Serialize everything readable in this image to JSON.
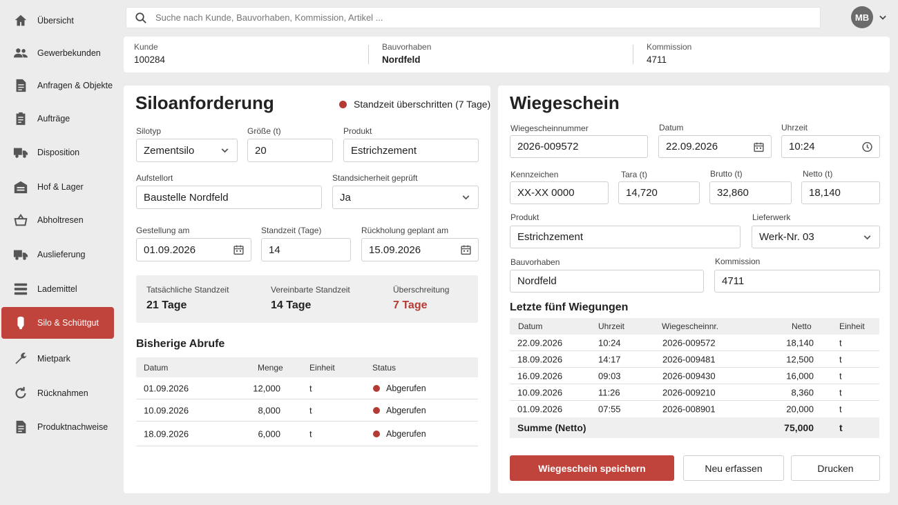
{
  "sidebar": {
    "items": [
      {
        "label": "Übersicht",
        "icon": "home-icon"
      },
      {
        "label": "Gewerbekunden",
        "icon": "users-icon"
      },
      {
        "label": "Anfragen & Objekte",
        "icon": "document-icon"
      },
      {
        "label": "Aufträge",
        "icon": "clipboard-icon"
      },
      {
        "label": "Disposition",
        "icon": "truck-icon"
      },
      {
        "label": "Hof & Lager",
        "icon": "warehouse-icon"
      },
      {
        "label": "Abholtresen",
        "icon": "basket-icon"
      },
      {
        "label": "Auslieferung",
        "icon": "delivery-truck-icon"
      },
      {
        "label": "Lademittel",
        "icon": "pallet-icon"
      },
      {
        "label": "Silo & Schüttgut",
        "icon": "silo-icon",
        "active": true
      },
      {
        "label": "Mietpark",
        "icon": "wrench-icon"
      },
      {
        "label": "Rücknahmen",
        "icon": "return-icon"
      },
      {
        "label": "Produktnachweise",
        "icon": "certificate-icon"
      }
    ]
  },
  "search": {
    "placeholder": "Suche nach Kunde, Bauvorhaben, Kommission, Artikel ..."
  },
  "user": {
    "initials": "MB"
  },
  "info": {
    "kunde_label": "Kunde",
    "kunde_value": "100284",
    "bauvorhaben_label": "Bauvorhaben",
    "bauvorhaben_value": "Nordfeld",
    "kommission_label": "Kommission",
    "kommission_value": "4711"
  },
  "silo": {
    "title": "Siloanforderung",
    "warning": "Standzeit überschritten (7 Tage)",
    "silotyp_label": "Silotyp",
    "silotyp_value": "Zementsilo",
    "groesse_label": "Größe (t)",
    "groesse_value": "20",
    "produkt_label": "Produkt",
    "produkt_value": "Estrichzement",
    "aufstellort_label": "Aufstellort",
    "aufstellort_value": "Baustelle Nordfeld",
    "standsicherheit_label": "Standsicherheit geprüft",
    "standsicherheit_value": "Ja",
    "gestellung_label": "Gestellung am",
    "gestellung_value": "01.09.2026",
    "standzeit_label": "Standzeit (Tage)",
    "standzeit_value": "14",
    "rueckholung_label": "Rückholung geplant am",
    "rueckholung_value": "15.09.2026",
    "summary": {
      "actual_label": "Tatsächliche Standzeit",
      "actual_value": "21 Tage",
      "agreed_label": "Vereinbarte Standzeit",
      "agreed_value": "14 Tage",
      "over_label": "Überschreitung",
      "over_value": "7 Tage"
    },
    "abrufe_title": "Bisherige Abrufe",
    "abrufe_headers": [
      "Datum",
      "Menge",
      "Einheit",
      "Status"
    ],
    "abrufe_rows": [
      {
        "datum": "01.09.2026",
        "menge": "12,000",
        "einheit": "t",
        "status": "Abgerufen"
      },
      {
        "datum": "10.09.2026",
        "menge": "8,000",
        "einheit": "t",
        "status": "Abgerufen"
      },
      {
        "datum": "18.09.2026",
        "menge": "6,000",
        "einheit": "t",
        "status": "Abgerufen"
      }
    ]
  },
  "wiege": {
    "title": "Wiegeschein",
    "nummer_label": "Wiegescheinnummer",
    "nummer_value": "2026-009572",
    "datum_label": "Datum",
    "datum_value": "22.09.2026",
    "uhrzeit_label": "Uhrzeit",
    "uhrzeit_value": "10:24",
    "kennzeichen_label": "Kennzeichen",
    "kennzeichen_value": "XX-XX 0000",
    "tara_label": "Tara (t)",
    "tara_value": "14,720",
    "brutto_label": "Brutto (t)",
    "brutto_value": "32,860",
    "netto_label": "Netto (t)",
    "netto_value": "18,140",
    "produkt_label": "Produkt",
    "produkt_value": "Estrichzement",
    "lieferwerk_label": "Lieferwerk",
    "lieferwerk_value": "Werk-Nr. 03",
    "bauvorhaben_label": "Bauvorhaben",
    "bauvorhaben_value": "Nordfeld",
    "kommission_label": "Kommission",
    "kommission_value": "4711",
    "recent_title": "Letzte fünf Wiegungen",
    "recent_headers": [
      "Datum",
      "Uhrzeit",
      "Wiegescheinnr.",
      "Netto",
      "Einheit"
    ],
    "recent_rows": [
      {
        "datum": "22.09.2026",
        "uhrzeit": "10:24",
        "nr": "2026-009572",
        "netto": "18,140",
        "einheit": "t"
      },
      {
        "datum": "18.09.2026",
        "uhrzeit": "14:17",
        "nr": "2026-009481",
        "netto": "12,500",
        "einheit": "t"
      },
      {
        "datum": "16.09.2026",
        "uhrzeit": "09:03",
        "nr": "2026-009430",
        "netto": "16,000",
        "einheit": "t"
      },
      {
        "datum": "10.09.2026",
        "uhrzeit": "11:26",
        "nr": "2026-009210",
        "netto": "8,360",
        "einheit": "t"
      },
      {
        "datum": "01.09.2026",
        "uhrzeit": "07:55",
        "nr": "2026-008901",
        "netto": "20,000",
        "einheit": "t"
      }
    ],
    "sum_label": "Summe (Netto)",
    "sum_value": "75,000",
    "sum_unit": "t",
    "save_label": "Wiegeschein speichern",
    "new_label": "Neu erfassen",
    "print_label": "Drucken"
  },
  "colors": {
    "accent": "#c0443c",
    "status_dot": "#b53a34",
    "background": "#ececec"
  }
}
